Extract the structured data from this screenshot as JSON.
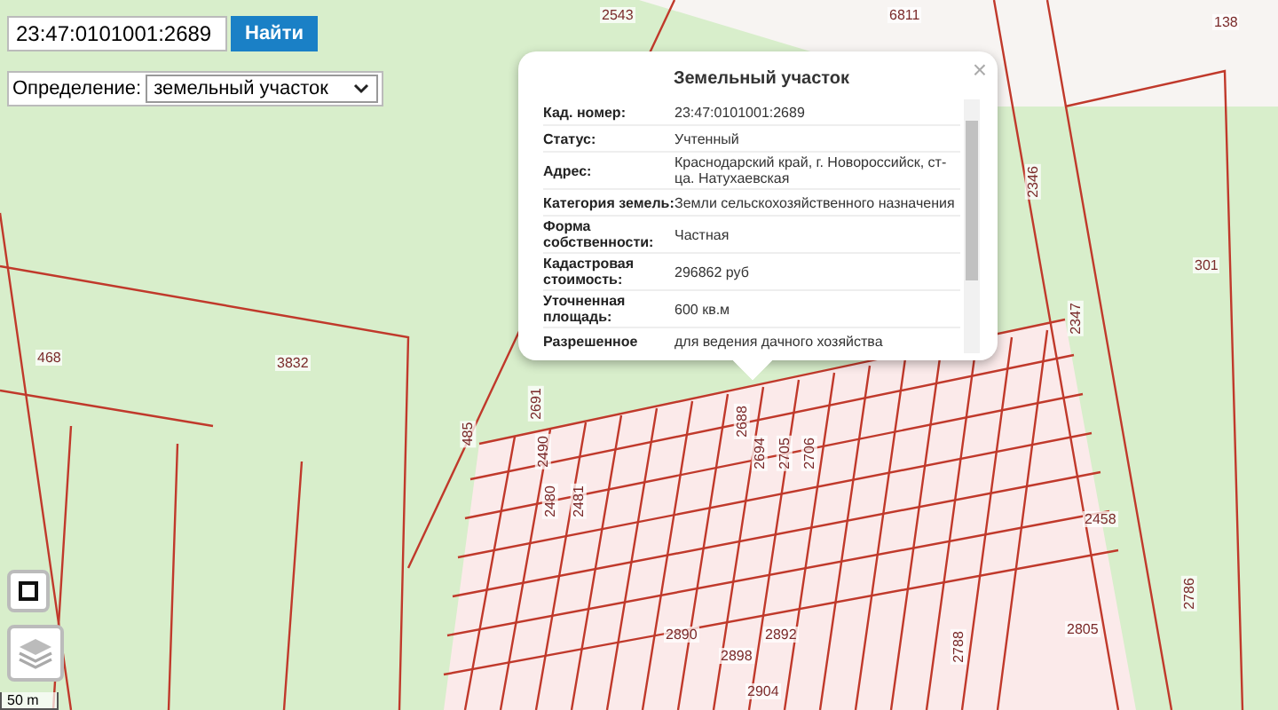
{
  "search": {
    "value": "23:47:0101001:2689",
    "button": "Найти"
  },
  "definition": {
    "label": "Определение:",
    "value": "земельный участок"
  },
  "popup": {
    "title": "Земельный участок",
    "close": "×",
    "rows": [
      {
        "label": "Кад. номер:",
        "value": "23:47:0101001:2689"
      },
      {
        "label": "Статус:",
        "value": "Учтенный"
      },
      {
        "label": "Адрес:",
        "value": "Краснодарский край, г. Новороссийск, ст-ца. Натухаевская"
      },
      {
        "label": "Категория земель:",
        "value": "Земли сельскохозяйственного назначения"
      },
      {
        "label": "Форма собственности:",
        "value": "Частная"
      },
      {
        "label": "Кадастровая стоимость:",
        "value": "296862 руб"
      },
      {
        "label": "Уточненная площадь:",
        "value": "600 кв.м"
      },
      {
        "label": "Разрешенное",
        "value": "для ведения дачного хозяйства"
      }
    ]
  },
  "map_labels": [
    "2543",
    "6811",
    "138",
    "2346",
    "301",
    "2347",
    "468",
    "3832",
    "485",
    "2691",
    "2688",
    "2694",
    "2705",
    "2706",
    "2490",
    "2480",
    "2481",
    "2890",
    "2892",
    "2898",
    "2904",
    "2788",
    "2786",
    "2458",
    "2805"
  ],
  "scale": "50 m"
}
